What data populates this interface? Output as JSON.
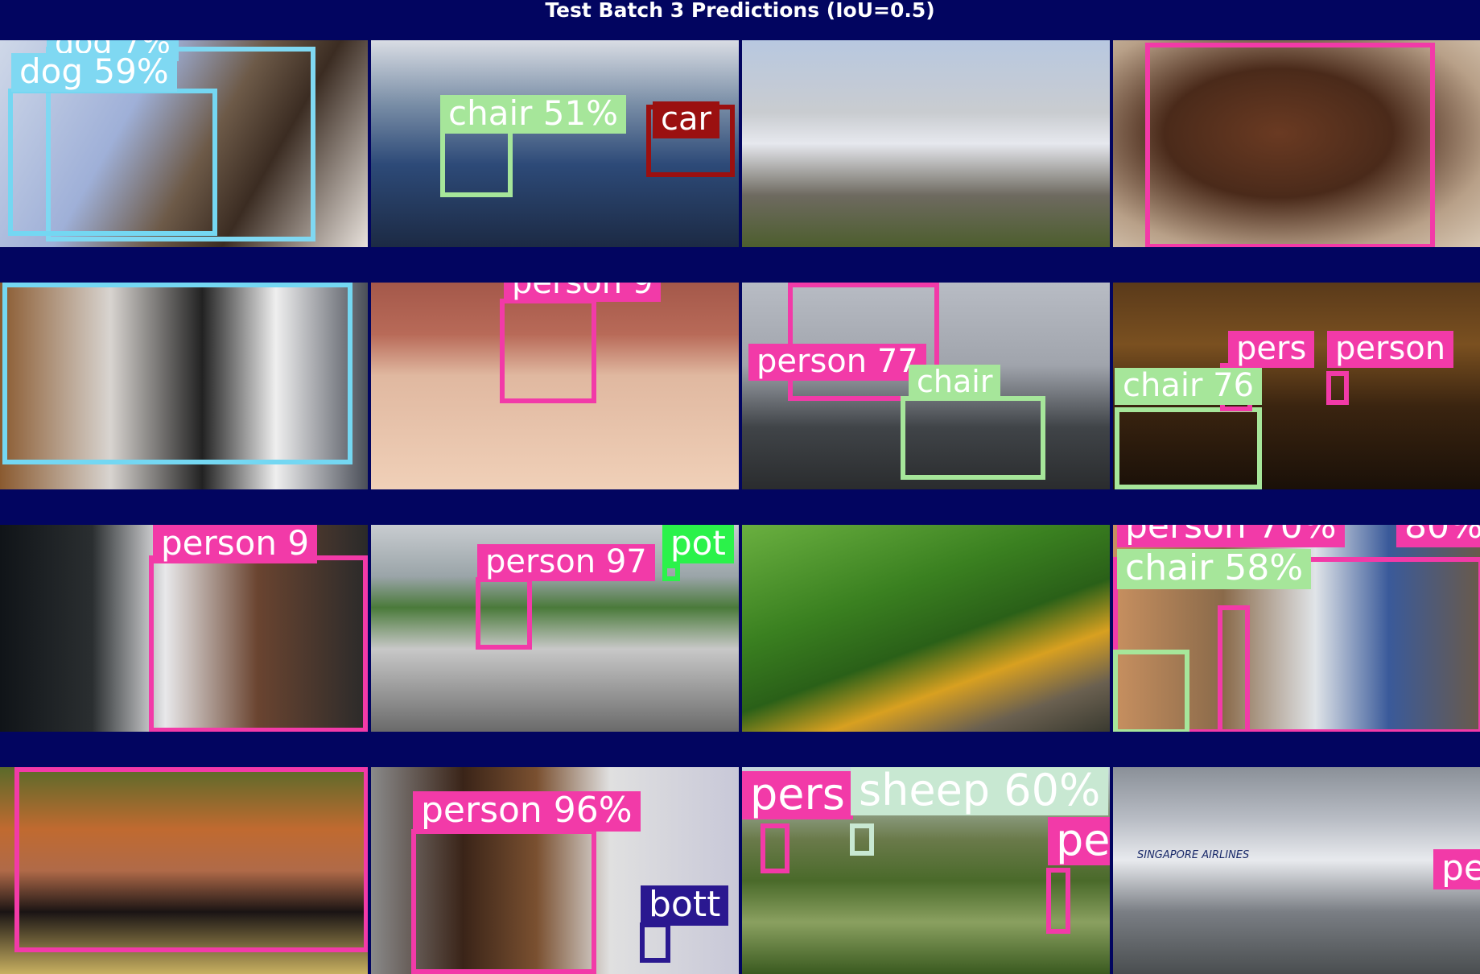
{
  "title": "Test Batch 3 Predictions (IoU=0.5)",
  "colors": {
    "background": "#020560",
    "dog": "#7fd8f2",
    "cat": "#74d7f2",
    "chair": "#a6e69a",
    "car": "#9b1010",
    "person": "#f23aa8",
    "potted_plant": "#2bf24a",
    "sheep": "#c8e8d2",
    "bottle": "#2a1890",
    "label_text": "#ffffff"
  },
  "tiles": [
    {
      "scene": "cats-on-blanket",
      "labels": [
        {
          "text": "dog 59%",
          "class": "dog"
        },
        {
          "text": "dog 7%",
          "class": "dog"
        }
      ]
    },
    {
      "scene": "bus-door",
      "labels": [
        {
          "text": "chair 51%",
          "class": "chair"
        },
        {
          "text": "car",
          "class": "car"
        }
      ]
    },
    {
      "scene": "train-on-tracks",
      "labels": []
    },
    {
      "scene": "woman-on-phone",
      "labels": []
    },
    {
      "scene": "two-cats",
      "labels": []
    },
    {
      "scene": "breakdancer",
      "labels": [
        {
          "text": "person 9",
          "class": "person"
        }
      ]
    },
    {
      "scene": "jumping-woman",
      "labels": [
        {
          "text": "person 77",
          "class": "person"
        },
        {
          "text": "chair",
          "class": "chair"
        }
      ]
    },
    {
      "scene": "night-plaza",
      "labels": [
        {
          "text": "pers",
          "class": "person"
        },
        {
          "text": "person",
          "class": "person"
        },
        {
          "text": "chair 76",
          "class": "chair"
        }
      ]
    },
    {
      "scene": "christmas-village",
      "labels": [
        {
          "text": "person 9",
          "class": "person"
        }
      ]
    },
    {
      "scene": "bicycle",
      "labels": [
        {
          "text": "person 97",
          "class": "person"
        },
        {
          "text": "pot",
          "class": "potted_plant"
        }
      ]
    },
    {
      "scene": "green-train",
      "labels": []
    },
    {
      "scene": "guitar-players",
      "labels": [
        {
          "text": "person 70%",
          "class": "person"
        },
        {
          "text": "80%",
          "class": "person"
        },
        {
          "text": "chair 58%",
          "class": "chair"
        }
      ]
    },
    {
      "scene": "singer",
      "labels": []
    },
    {
      "scene": "woman-at-computer",
      "labels": [
        {
          "text": "person 96%",
          "class": "person"
        },
        {
          "text": "bott",
          "class": "bottle"
        }
      ]
    },
    {
      "scene": "field",
      "labels": [
        {
          "text": "pers",
          "class": "person"
        },
        {
          "text": "sheep 60%",
          "class": "sheep"
        },
        {
          "text": "pe",
          "class": "person"
        }
      ]
    },
    {
      "scene": "airplane",
      "labels": [
        {
          "text": "pe",
          "class": "person"
        },
        {
          "text": "SINGAPORE AIRLINES",
          "class": "aircraft_livery"
        }
      ]
    }
  ]
}
